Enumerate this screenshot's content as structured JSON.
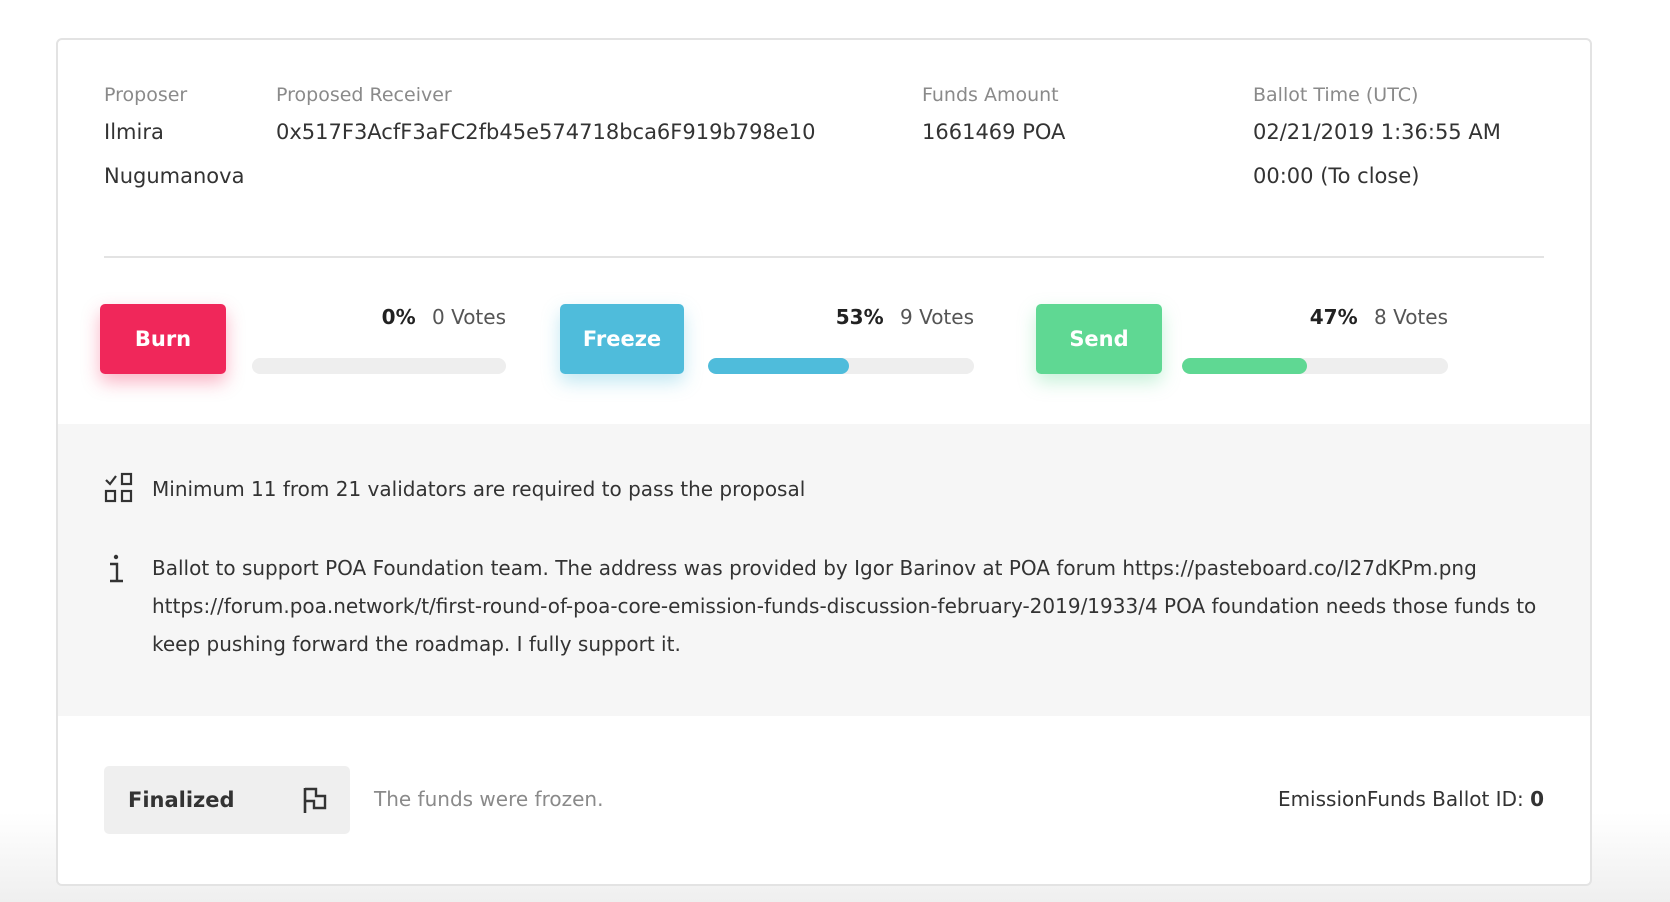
{
  "details": {
    "proposer_label": "Proposer",
    "proposer_value": "Ilmira Nugumanova",
    "receiver_label": "Proposed Receiver",
    "receiver_value": "0x517F3AcfF3aFC2fb45e574718bca6F919b798e10",
    "funds_label": "Funds Amount",
    "funds_value": "1661469 POA",
    "time_label": "Ballot Time (UTC)",
    "time_value": "02/21/2019 1:36:55 AM",
    "time_remaining": "00:00 (To close)"
  },
  "votes": {
    "burn": {
      "label": "Burn",
      "percent": "0%",
      "votes": "0 Votes",
      "fraction": 0.0,
      "color": "#f0275a"
    },
    "freeze": {
      "label": "Freeze",
      "percent": "53%",
      "votes": "9 Votes",
      "fraction": 0.53,
      "color": "#4fbcdb"
    },
    "send": {
      "label": "Send",
      "percent": "47%",
      "votes": "8 Votes",
      "fraction": 0.47,
      "color": "#5fd893"
    }
  },
  "notes": {
    "validators_icon": "checklist-grid-icon",
    "validators_text": "Minimum 11 from 21 validators are required to pass the proposal",
    "description_icon": "info-icon",
    "description_text": "Ballot to support POA Foundation team. The address was provided by Igor Barinov at POA forum https://pasteboard.co/I27dKPm.png https://forum.poa.network/t/first-round-of-poa-core-emission-funds-discussion-february-2019/1933/4 POA foundation needs those funds to keep pushing forward the roadmap. I fully support it."
  },
  "footer": {
    "status_label": "Finalized",
    "status_icon": "flag-icon",
    "status_description": "The funds were frozen.",
    "ballot_id_label": "EmissionFunds Ballot ID: ",
    "ballot_id_value": "0"
  }
}
